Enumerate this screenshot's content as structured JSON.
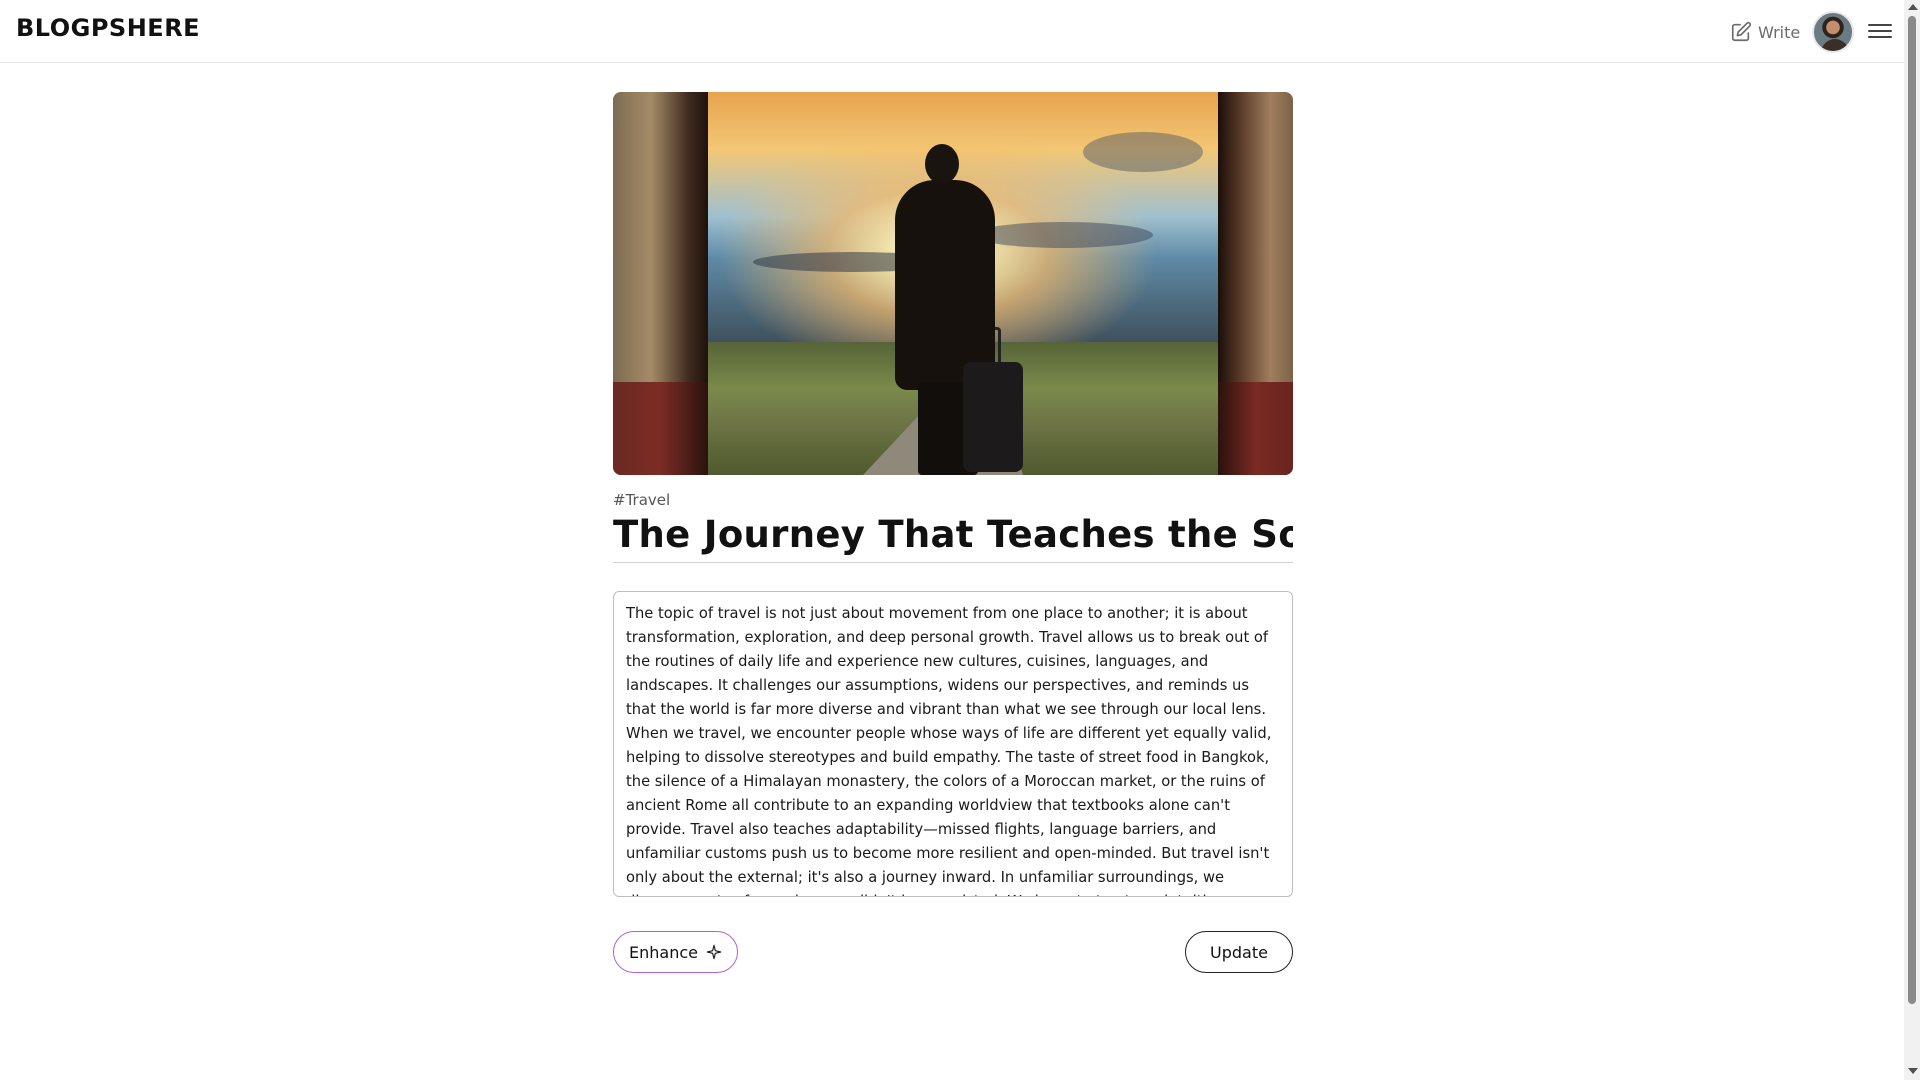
{
  "header": {
    "logo": "BLOGPSHERE",
    "write_label": "Write",
    "write_icon": "edit-icon",
    "avatar_icon": "avatar",
    "menu_icon": "hamburger-menu-icon"
  },
  "post": {
    "tag": "#Travel",
    "title": "The Journey That Teaches the So",
    "body": "The topic of travel is not just about movement from one place to another; it is about transformation, exploration, and deep personal growth. Travel allows us to break out of the routines of daily life and experience new cultures, cuisines, languages, and landscapes. It challenges our assumptions, widens our perspectives, and reminds us that the world is far more diverse and vibrant than what we see through our local lens. When we travel, we encounter people whose ways of life are different yet equally valid, helping to dissolve stereotypes and build empathy. The taste of street food in Bangkok, the silence of a Himalayan monastery, the colors of a Moroccan market, or the ruins of ancient Rome all contribute to an expanding worldview that textbooks alone can't provide. Travel also teaches adaptability—missed flights, language barriers, and unfamiliar customs push us to become more resilient and open-minded. But travel isn't only about the external; it's also a journey inward. In unfamiliar surroundings, we discover parts of ourselves we didn't know existed. We learn to trust our intuition, embrace uncertainty, and find joy in spontaneity. The topic of travel"
  },
  "actions": {
    "enhance_label": "Enhance",
    "enhance_icon": "sparkle-icon",
    "update_label": "Update"
  },
  "colors": {
    "enhance_border": "#b061d4",
    "header_border": "#e4e4e4"
  }
}
